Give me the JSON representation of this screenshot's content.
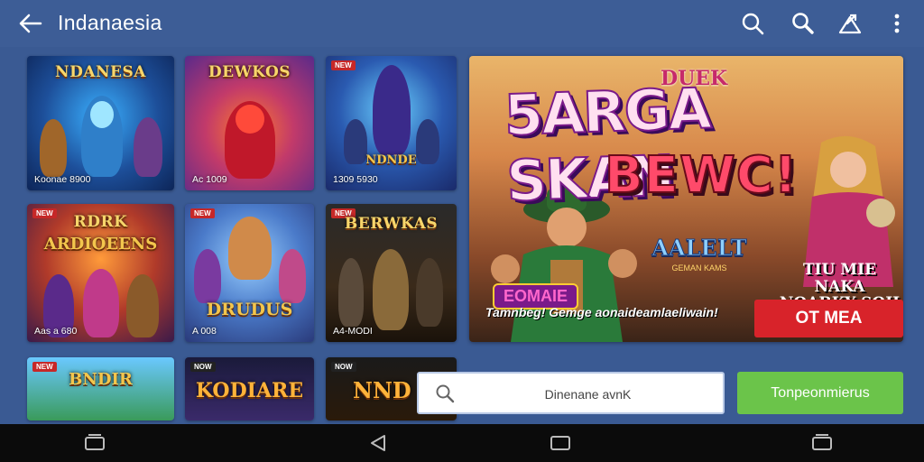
{
  "app": {
    "title": "Indanaesia"
  },
  "toolbar": {
    "icons": [
      "back-arrow-icon",
      "search-icon",
      "search-icon-2",
      "share-icon",
      "more-vert-icon"
    ]
  },
  "tiles": [
    {
      "title": "NDANESA",
      "sub": "",
      "caption": "Koonae 8900",
      "tag": ""
    },
    {
      "title": "DEWKOS",
      "sub": "",
      "caption": "Ac 1009",
      "tag": ""
    },
    {
      "title": "",
      "sub": "NDNDE",
      "caption": "1309 5930",
      "tag": "NEW"
    },
    {
      "title": "RDRK",
      "sub": "ARDIOEENS",
      "caption": "Aas a 680",
      "tag": "NEW"
    },
    {
      "title": "",
      "sub": "DRUDUS",
      "caption": "A 008",
      "tag": "NEW"
    },
    {
      "title": "BERWKAS",
      "sub": "",
      "caption": "A4-MODI",
      "tag": "NEW"
    },
    {
      "title": "",
      "sub": "BNDIR",
      "caption": "",
      "tag": "NEW"
    },
    {
      "title": "",
      "sub": "KODIARE",
      "caption": "",
      "tag": "NOW"
    },
    {
      "title": "",
      "sub": "NND",
      "caption": "",
      "tag": "NOW"
    }
  ],
  "banner": {
    "top": "DUEK",
    "headline": "5ARGA SKAN",
    "headline2": "BEWC!",
    "logo": "AALELT",
    "logo_sub": "GEMAN KAMS",
    "badge": "EOMAIE",
    "promo_line1": "TIU MIE NAKA",
    "promo_line2": "NOABKY SOII",
    "strip": "Tamnbeg! Gemge aonaideamlaeliwain!",
    "cta": "OT MEA"
  },
  "search": {
    "placeholder": "Dinenane avnK"
  },
  "action_button": {
    "label": "Tonpeonmierus"
  },
  "navbar": {
    "icons": [
      "recents-icon",
      "back-icon",
      "home-icon",
      "overview-icon"
    ]
  },
  "colors": {
    "background": "#3a5a93",
    "cta_red": "#d8232a",
    "action_green": "#6bc44a",
    "navbar": "#0b0b0b"
  }
}
